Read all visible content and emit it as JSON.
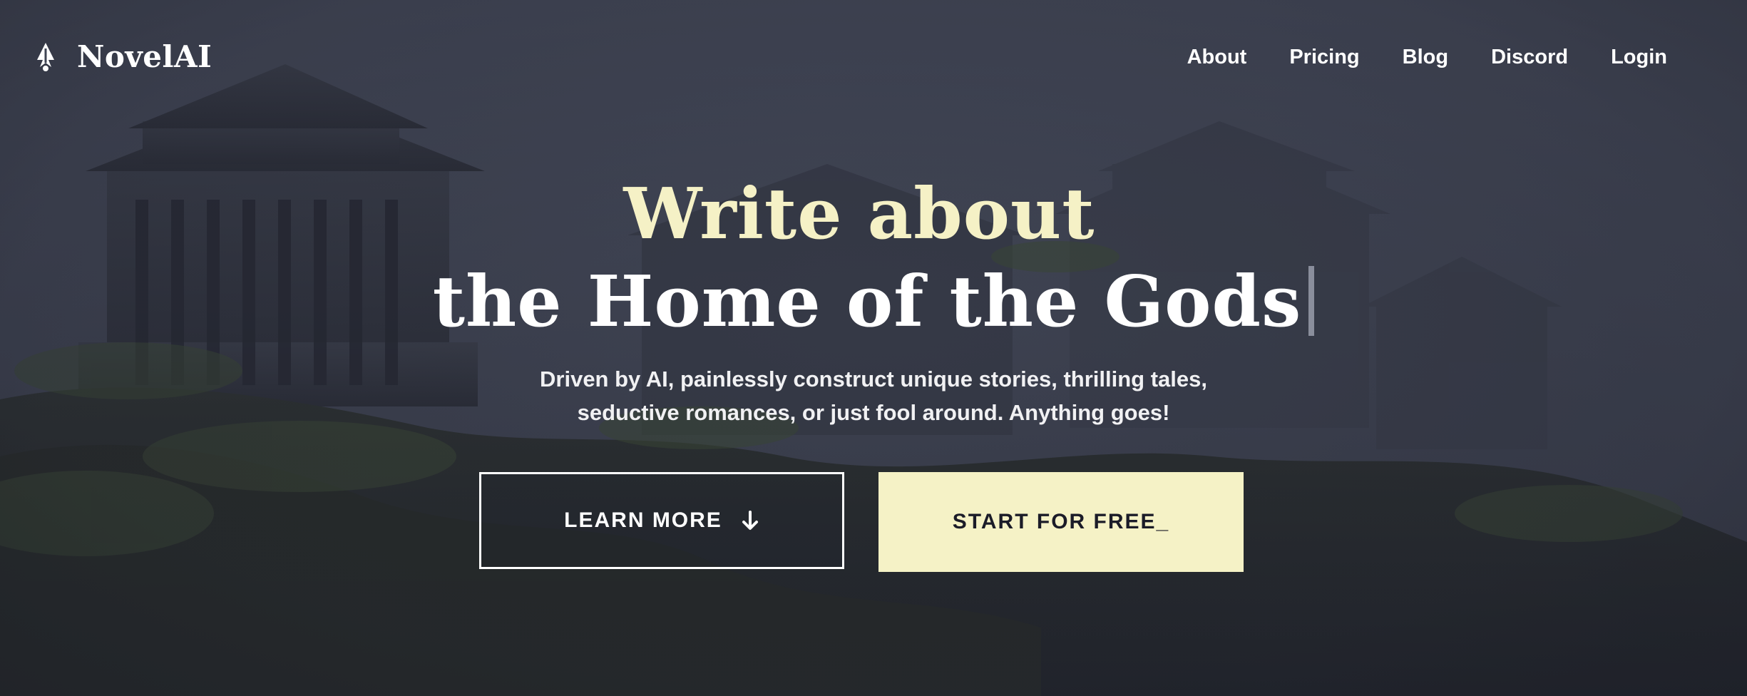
{
  "brand": {
    "name": "NovelAI",
    "logo_icon": "quill-feather-icon"
  },
  "nav": {
    "items": [
      {
        "label": "About"
      },
      {
        "label": "Pricing"
      },
      {
        "label": "Blog"
      },
      {
        "label": "Discord"
      },
      {
        "label": "Login"
      }
    ]
  },
  "hero": {
    "headline_line1": "Write about",
    "headline_line2": "the Home of the Gods",
    "subtitle_line1": "Driven by AI, painlessly construct unique stories, thrilling tales,",
    "subtitle_line2": "seductive romances, or just fool around. Anything goes!",
    "learn_more_label": "LEARN MORE",
    "learn_more_icon": "arrow-down-icon",
    "start_label": "START FOR FREE_"
  },
  "colors": {
    "accent": "#f5f2c6",
    "background": "#3f4453",
    "text": "#ffffff",
    "button_text_dark": "#1b1c28"
  }
}
